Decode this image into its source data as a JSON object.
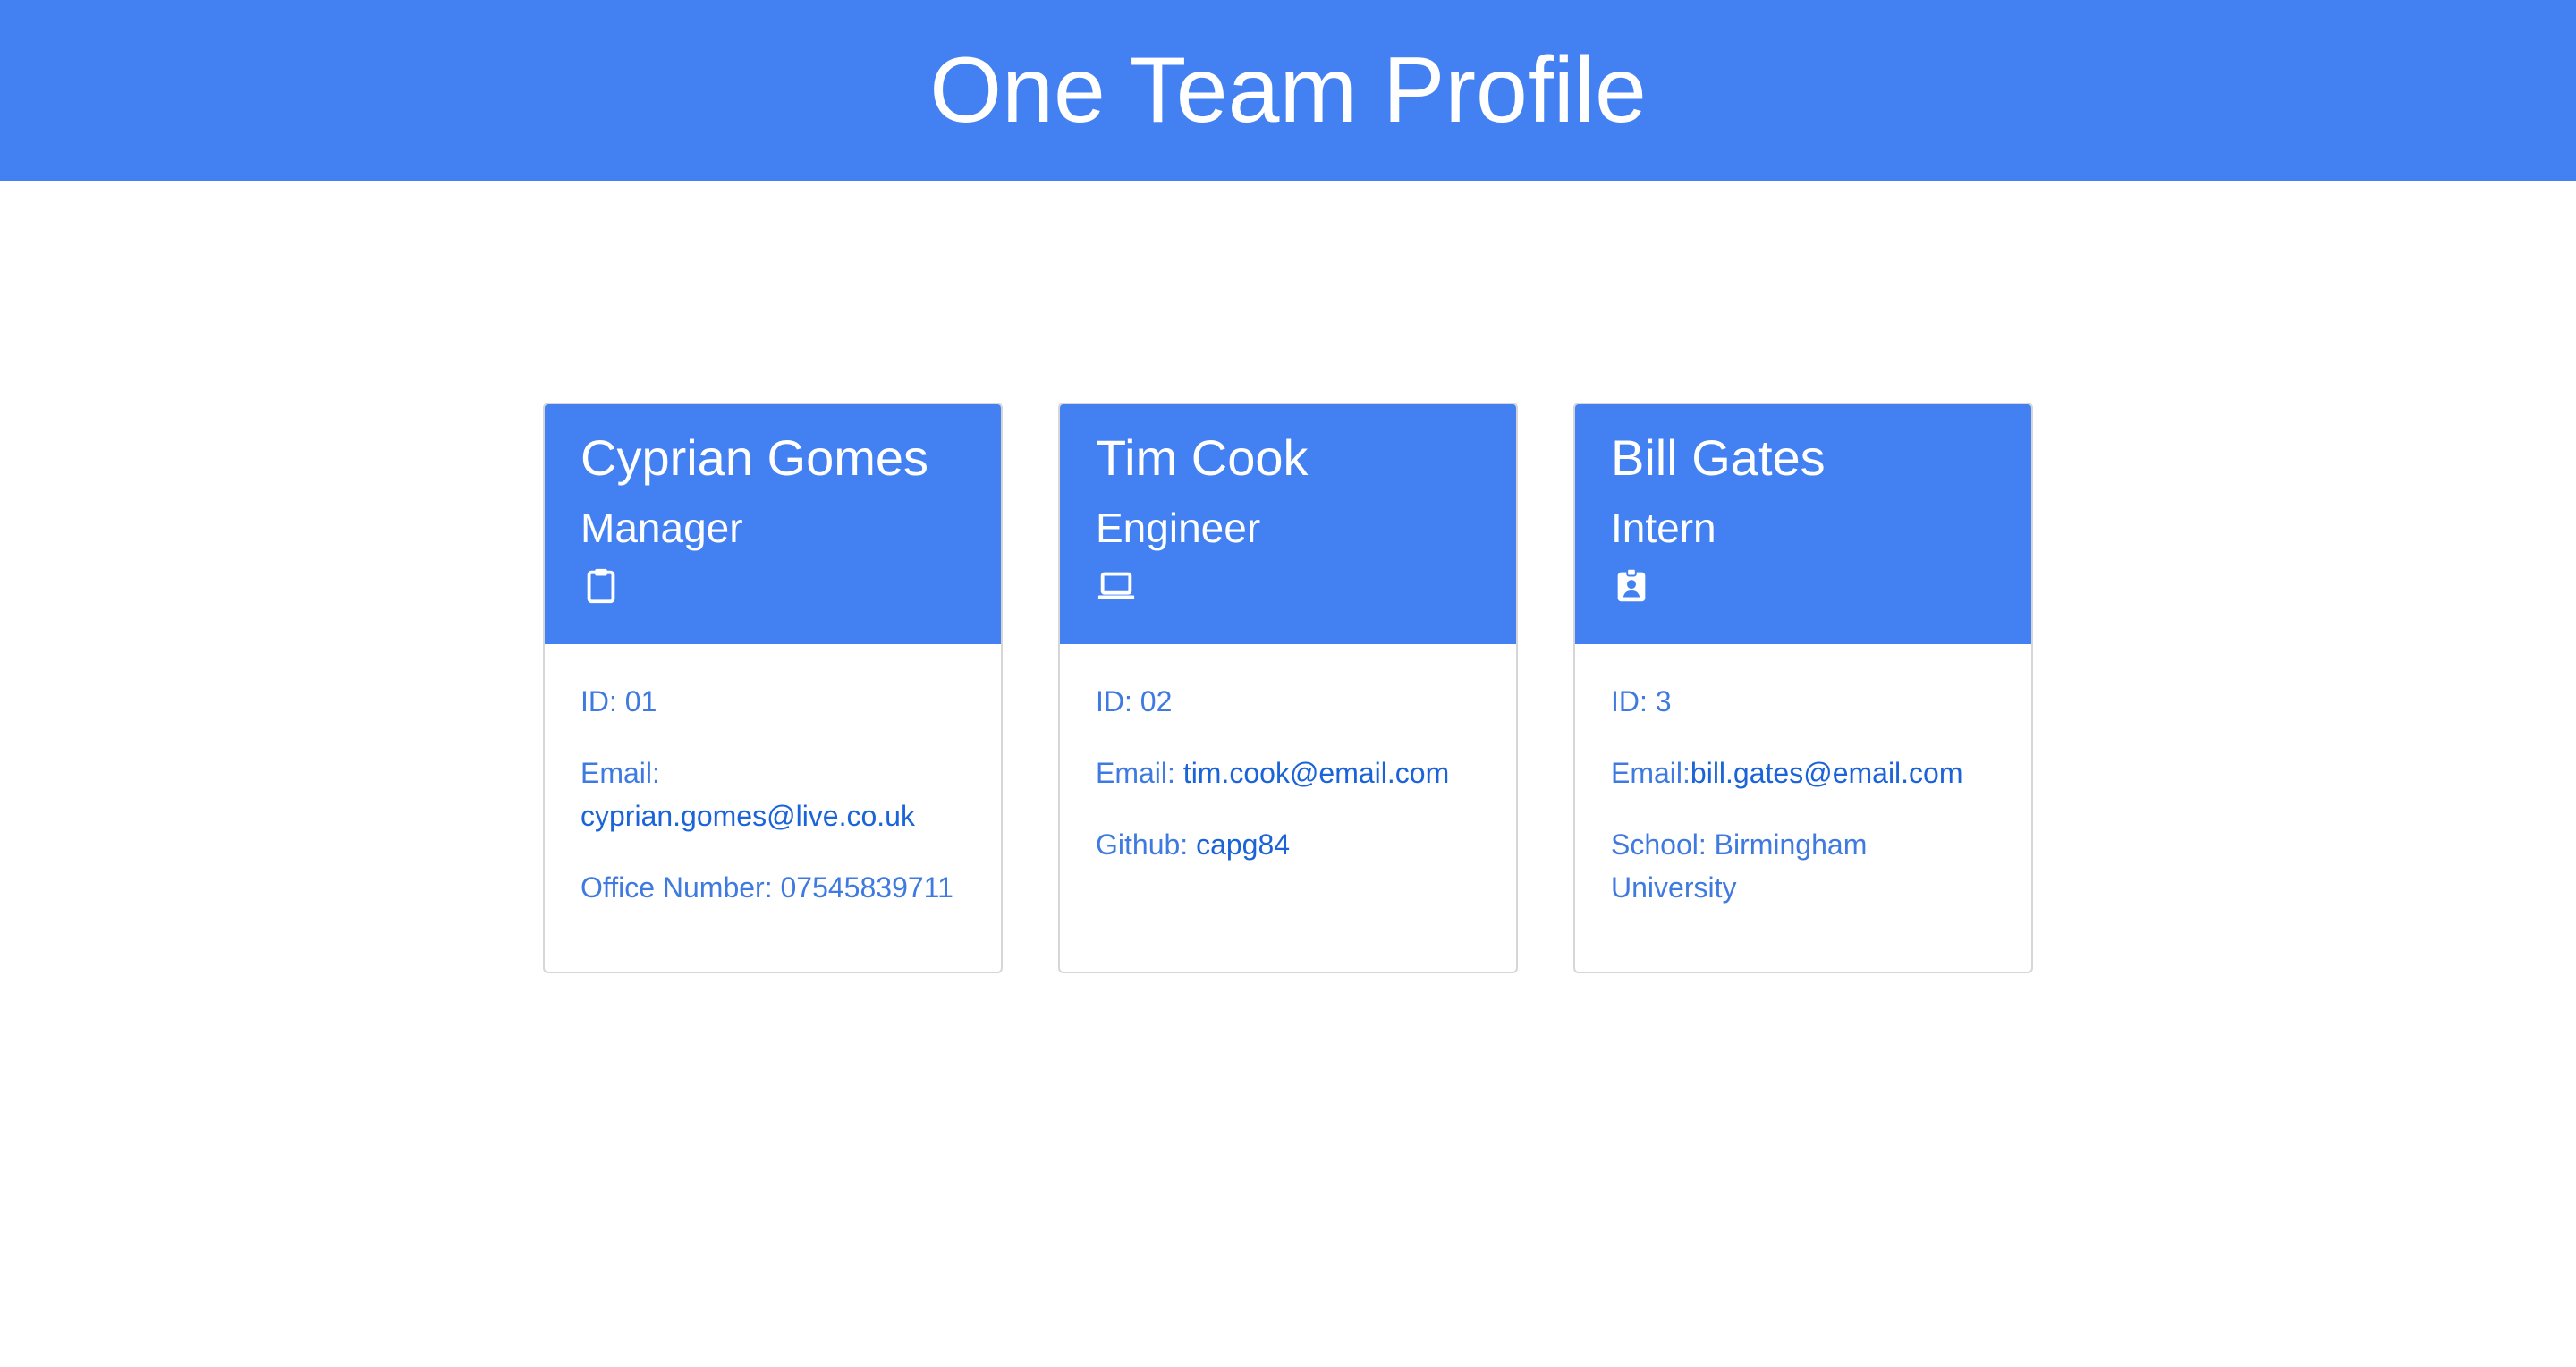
{
  "header": {
    "title": "One Team Profile"
  },
  "colors": {
    "accent": "#4381f3",
    "text_link": "#1b63d8",
    "text_field": "#3f7ae0"
  },
  "cards": [
    {
      "name": "Cyprian Gomes",
      "role": "Manager",
      "icon": "clipboard-icon",
      "id_label": "ID: 01",
      "email_label": "Email:",
      "email": "cyprian.gomes@live.co.uk",
      "extra_label": "Office Number: 07545839711"
    },
    {
      "name": "Tim Cook",
      "role": "Engineer",
      "icon": "laptop-icon",
      "id_label": "ID: 02",
      "email_label": "Email:",
      "email": "tim.cook@email.com",
      "extra_label": "Github:",
      "extra_link": "capg84"
    },
    {
      "name": "Bill Gates",
      "role": "Intern",
      "icon": "id-badge-icon",
      "id_label": "ID: 3",
      "email_label": "Email:",
      "email": "bill.gates@email.com",
      "extra_label": "School: Birmingham University"
    }
  ]
}
